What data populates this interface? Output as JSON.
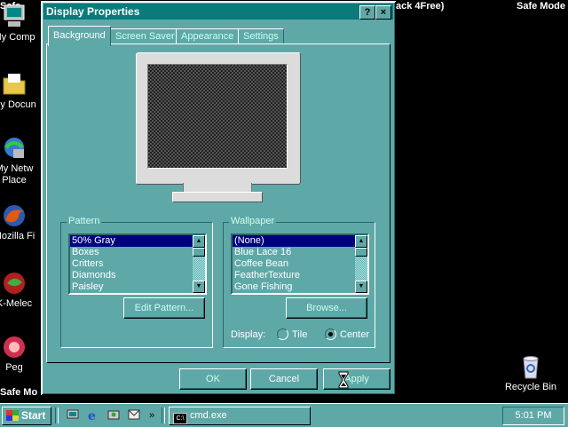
{
  "desktop": {
    "safe_mode_top_left": "Safe",
    "safe_mode_top_right": "Safe Mode",
    "safe_mode_bottom_left": "Safe Mo",
    "behind_window_title": "ack 4Free)",
    "icons": [
      {
        "name": "my-computer",
        "label": "My Comp"
      },
      {
        "name": "my-documents",
        "label": "My Docun"
      },
      {
        "name": "network-places",
        "label_line1": "My Netw",
        "label_line2": "Place"
      },
      {
        "name": "mozilla-firefox",
        "label": "Mozilla Fi"
      },
      {
        "name": "k-meleon",
        "label": "K-Melec"
      },
      {
        "name": "pegasus",
        "label": "Peg"
      },
      {
        "name": "recycle-bin",
        "label": "Recycle Bin"
      }
    ]
  },
  "window": {
    "title": "Display Properties",
    "help_button": "?",
    "close_button": "×",
    "tabs": [
      "Background",
      "Screen Saver",
      "Appearance",
      "Settings"
    ],
    "pattern": {
      "group_label": "Pattern",
      "items": [
        "50% Gray",
        "Boxes",
        "Critters",
        "Diamonds",
        "Paisley"
      ],
      "selected": "50% Gray",
      "edit_button": "Edit Pattern..."
    },
    "wallpaper": {
      "group_label": "Wallpaper",
      "items": [
        "(None)",
        "Blue Lace 16",
        "Coffee Bean",
        "FeatherTexture",
        "Gone Fishing"
      ],
      "selected": "(None)",
      "browse_button": "Browse...",
      "display_label": "Display:",
      "options": [
        "Tile",
        "Center"
      ],
      "selected_option": "Center"
    },
    "buttons": {
      "ok": "OK",
      "cancel": "Cancel",
      "apply": "Apply"
    }
  },
  "taskbar": {
    "start_label": "Start",
    "quick_launch": [
      "show-desktop-icon",
      "internet-explorer-icon",
      "channels-icon",
      "outlook-icon"
    ],
    "overflow": "»",
    "task": "cmd.exe",
    "clock": "5:01 PM"
  },
  "colors": {
    "desktop": "#000000",
    "window_face": "#5fa8a8",
    "title_bar": "#0a7a7a",
    "selection": "#000080"
  }
}
